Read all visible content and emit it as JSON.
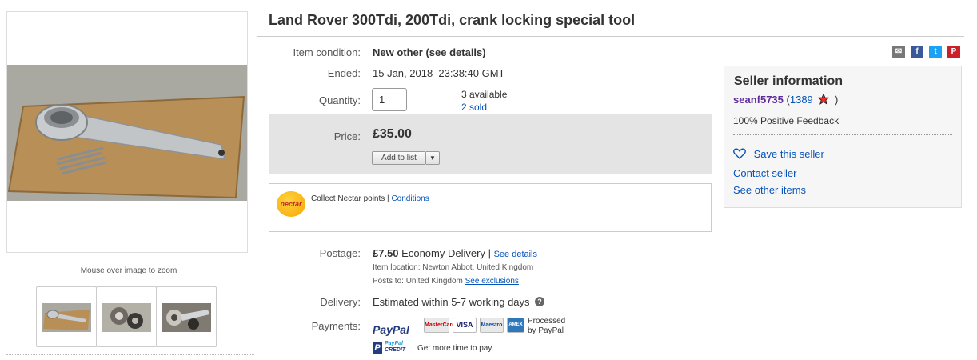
{
  "gallery": {
    "zoom_hint": "Mouse over image to zoom"
  },
  "title": "Land Rover 300Tdi, 200Tdi, crank locking special tool",
  "details": {
    "condition_label": "Item condition:",
    "condition_value": "New other (see details)",
    "ended_label": "Ended:",
    "ended_value": "15 Jan, 2018  23:38:40 GMT",
    "quantity_label": "Quantity:",
    "quantity_value": "1",
    "available": "3 available",
    "sold": "2 sold"
  },
  "price": {
    "label": "Price:",
    "value": "£35.00",
    "add_to_list": "Add to list",
    "dropdown_glyph": "▼"
  },
  "nectar": {
    "logo_text": "nectar",
    "text": "Collect Nectar points",
    "separator": "|",
    "conditions": "Conditions"
  },
  "postage": {
    "label": "Postage:",
    "price": "£7.50",
    "method": "Economy Delivery",
    "separator": "|",
    "see_details": "See details",
    "location_label": "Item location:",
    "location": "Newton Abbot, United Kingdom",
    "posts_to_label": "Posts to:",
    "posts_to": "United Kingdom",
    "exclusions": "See exclusions"
  },
  "delivery": {
    "label": "Delivery:",
    "value": "Estimated within 5-7 working days",
    "help_glyph": "?"
  },
  "payments": {
    "label": "Payments:",
    "paypal": "PayPal",
    "cards": [
      "MasterCard",
      "VISA",
      "Maestro",
      "AMEX"
    ],
    "processed": "Processed",
    "by_paypal": "by PayPal",
    "credit_top": "PayPal",
    "credit_bottom": "CREDIT",
    "credit_text": "Get more time to pay."
  },
  "share": {
    "email_glyph": "✉",
    "facebook_glyph": "f",
    "twitter_glyph": "t",
    "pinterest_glyph": "P"
  },
  "seller": {
    "title": "Seller information",
    "name": "seanf5735",
    "open_paren": "(",
    "score": "1389",
    "close_paren": ")",
    "feedback": "100% Positive Feedback",
    "save": "Save this seller",
    "contact": "Contact seller",
    "other": "See other items"
  },
  "colors": {
    "link": "#0654ba",
    "seller_name": "#5d2b9c",
    "price_bg": "#e4e4e4",
    "facebook": "#3b5998",
    "twitter": "#1da1f2",
    "pinterest": "#cb2027",
    "star": "#e62e2e"
  }
}
